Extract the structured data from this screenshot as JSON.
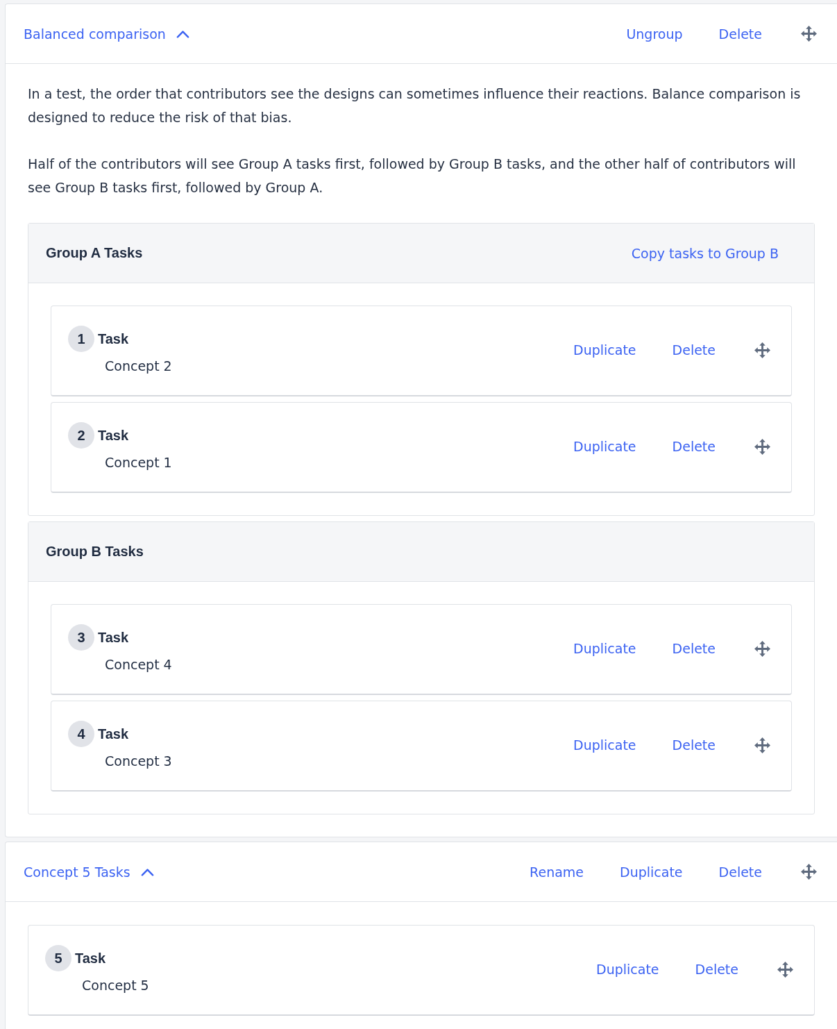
{
  "sections": [
    {
      "title": "Balanced comparison",
      "expanded": true,
      "actions": [
        "Ungroup",
        "Delete"
      ],
      "description": [
        "In a test, the order that contributors see the designs can sometimes influence their reactions. Balance comparison is designed to reduce the risk of that bias.",
        "Half of the contributors will see Group A tasks first, followed by Group B tasks, and the other half of contributors will see Group B tasks first, followed by Group A."
      ],
      "groups": [
        {
          "title": "Group A Tasks",
          "action": "Copy tasks to Group B",
          "tasks": [
            {
              "number": "1",
              "title": "Task",
              "concept": "Concept 2",
              "actions": [
                "Duplicate",
                "Delete"
              ]
            },
            {
              "number": "2",
              "title": "Task",
              "concept": "Concept 1",
              "actions": [
                "Duplicate",
                "Delete"
              ]
            }
          ]
        },
        {
          "title": "Group B Tasks",
          "tasks": [
            {
              "number": "3",
              "title": "Task",
              "concept": "Concept 4",
              "actions": [
                "Duplicate",
                "Delete"
              ]
            },
            {
              "number": "4",
              "title": "Task",
              "concept": "Concept 3",
              "actions": [
                "Duplicate",
                "Delete"
              ]
            }
          ]
        }
      ]
    },
    {
      "title": "Concept 5 Tasks",
      "expanded": true,
      "actions": [
        "Rename",
        "Duplicate",
        "Delete"
      ],
      "tasks": [
        {
          "number": "5",
          "title": "Task",
          "concept": "Concept 5",
          "actions": [
            "Duplicate",
            "Delete"
          ]
        }
      ]
    }
  ]
}
